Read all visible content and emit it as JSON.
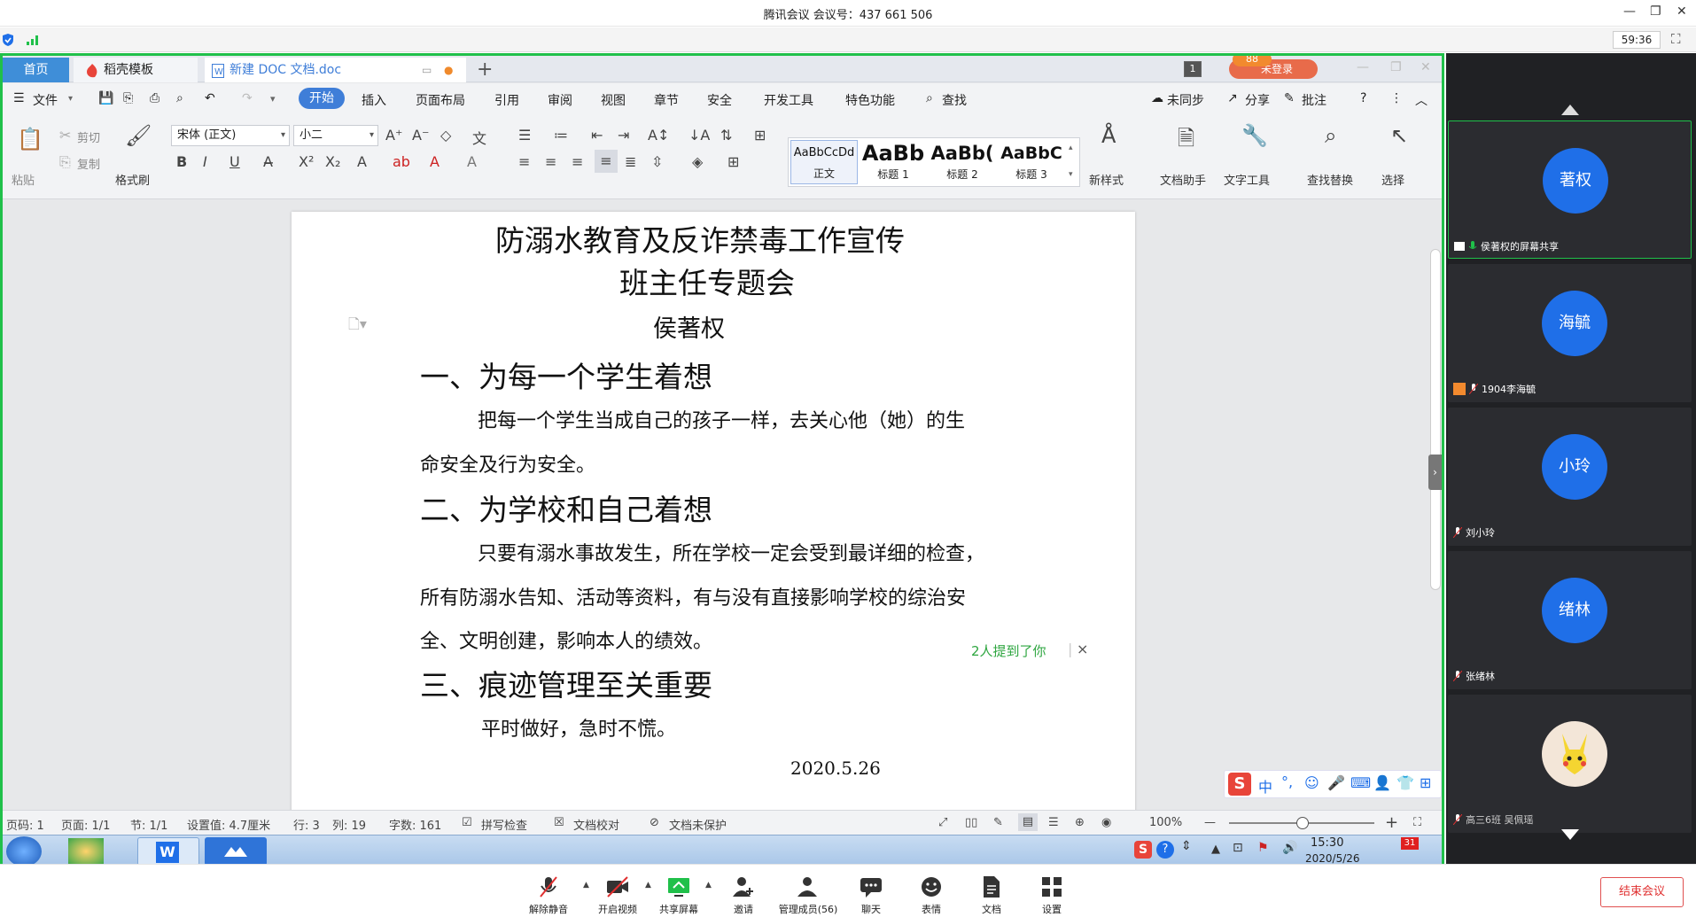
{
  "meeting": {
    "title": "腾讯会议 会议号：437 661 506",
    "timer": "59:36",
    "end_label": "结束会议"
  },
  "wps": {
    "tabs": {
      "home": "首页",
      "template": "稻壳模板",
      "doc": "新建 DOC 文档.doc"
    },
    "page_badge": "1",
    "login_badge": "88",
    "login_label": "未登录",
    "menu": {
      "file": "文件",
      "start": "开始",
      "insert": "插入",
      "layout": "页面布局",
      "ref": "引用",
      "review": "审阅",
      "view": "视图",
      "chapter": "章节",
      "security": "安全",
      "dev": "开发工具",
      "special": "特色功能",
      "search": "查找",
      "sync": "未同步",
      "share": "分享",
      "comment": "批注"
    },
    "ribbon": {
      "paste": "粘贴",
      "cut": "剪切",
      "copy": "复制",
      "format_painter": "格式刷",
      "font": "宋体 (正文)",
      "size": "小二",
      "styles": [
        {
          "preview": "AaBbCcDd",
          "name": "正文"
        },
        {
          "preview": "AaBb",
          "name": "标题 1"
        },
        {
          "preview": "AaBb(",
          "name": "标题 2"
        },
        {
          "preview": "AaBbC",
          "name": "标题 3"
        }
      ],
      "new_style": "新样式",
      "doc_helper": "文档助手",
      "text_tool": "文字工具",
      "find_replace": "查找替换",
      "select": "选择"
    }
  },
  "doc": {
    "title1": "防溺水教育及反诈禁毒工作宣传",
    "title2": "班主任专题会",
    "author": "侯著权",
    "h1": "一、为每一个学生着想",
    "p1a": "把每一个学生当成自己的孩子一样，去关心他（她）的生",
    "p1b": "命安全及行为安全。",
    "h2": "二、为学校和自己着想",
    "p2a": "只要有溺水事故发生，所在学校一定会受到最详细的检查，",
    "p2b": "所有防溺水告知、活动等资料，有与没有直接影响学校的综治安",
    "p2c": "全、文明创建，影响本人的绩效。",
    "h3": "三、痕迹管理至关重要",
    "p3": "平时做好，急时不慌。",
    "date": "2020.5.26"
  },
  "mention": {
    "text": "2人提到了你",
    "close": "×"
  },
  "ime": {
    "lang": "中"
  },
  "statusbar": {
    "page_no": "页码: 1",
    "pages": "页面: 1/1",
    "section": "节: 1/1",
    "setting": "设置值: 4.7厘米",
    "row": "行: 3",
    "col": "列: 19",
    "words": "字数: 161",
    "spell": "拼写检查",
    "proof": "文档校对",
    "protect": "文档未保护",
    "zoom": "100%"
  },
  "taskbar": {
    "time": "15:30",
    "date": "2020/5/26",
    "cal": "31"
  },
  "toolbar": [
    {
      "id": "unmute",
      "label": "解除静音"
    },
    {
      "id": "video",
      "label": "开启视频"
    },
    {
      "id": "share",
      "label": "共享屏幕"
    },
    {
      "id": "invite",
      "label": "邀请"
    },
    {
      "id": "members",
      "label": "管理成员(56)"
    },
    {
      "id": "chat",
      "label": "聊天"
    },
    {
      "id": "emoji",
      "label": "表情"
    },
    {
      "id": "docs",
      "label": "文档"
    },
    {
      "id": "settings",
      "label": "设置"
    }
  ],
  "participants": [
    {
      "avatar": "著权",
      "name": "侯著权的屏幕共享"
    },
    {
      "avatar": "海毓",
      "name": "1904李海毓"
    },
    {
      "avatar": "小玲",
      "name": "刘小玲"
    },
    {
      "avatar": "绪林",
      "name": "张绪林"
    },
    {
      "avatar": "",
      "name": "高三6班 吴佩瑶"
    }
  ],
  "colors": {
    "accent_green": "#20c04a",
    "wps_blue": "#3f7ed8",
    "avatar_blue": "#1f6fe8",
    "end_red": "#e03030"
  }
}
